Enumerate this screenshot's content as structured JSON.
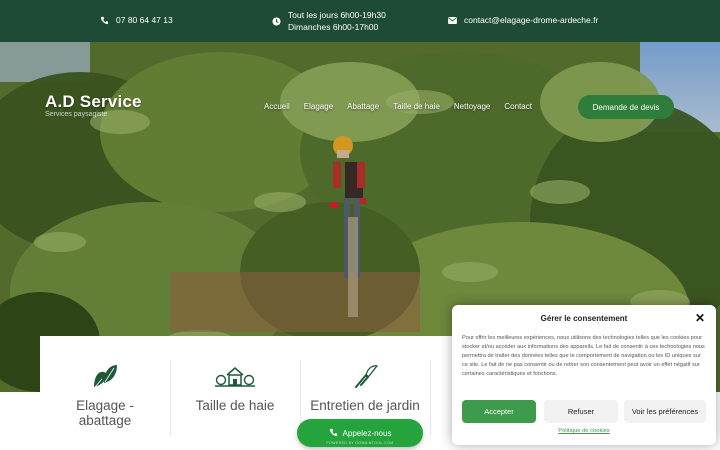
{
  "topbar": {
    "phone": "07 80 64 47 13",
    "hours_line1": "Tout les jours 6h00-19h30",
    "hours_line2": "Dimanches 6h00-17h00",
    "email": "contact@elagage-drome-ardeche.fr",
    "background": "#1d4b36"
  },
  "header": {
    "logo": "A.D Service",
    "logo_sub": "Services paysagiste",
    "nav": [
      "Accueil",
      "Elagage",
      "Abattage",
      "Taille de haie",
      "Nettoyage",
      "Contact"
    ],
    "quote_button": "Demande de devis"
  },
  "services": [
    {
      "label": "Elagage - abattage",
      "icon": "leaf-icon"
    },
    {
      "label": "Taille de haie",
      "icon": "house-hedge-icon"
    },
    {
      "label": "Entretien de jardin",
      "icon": "pruning-shears-icon"
    }
  ],
  "call_button": {
    "label": "Appelez-nous",
    "powered": "POWERED BY DOMAINTOOL.COM",
    "color": "#25a33c"
  },
  "consent": {
    "title": "Gérer le consentement",
    "text": "Pour offrir les meilleures expériences, nous utilisons des technologies telles que les cookies pour stocker et/ou accéder aux informations des appareils. Le fait de consentir à ces technologies nous permettra de traiter des données telles que le comportement de navigation ou les ID uniques sur ce site. Le fait de ne pas consentir ou de retirer son consentement peut avoir un effet négatif sur certaines caractéristiques et fonctions.",
    "accept": "Accepter",
    "refuse": "Refuser",
    "preferences": "Voir les préférences",
    "policy": "Politique de cookies",
    "accent": "#3e9b4c"
  }
}
